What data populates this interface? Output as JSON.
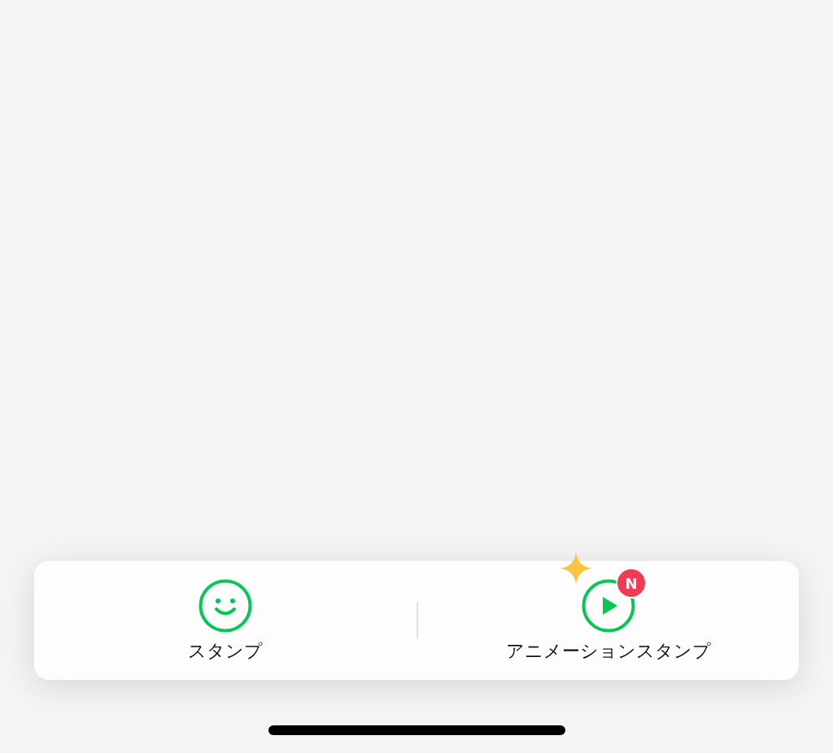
{
  "options": [
    {
      "kind": "smile",
      "label": "スタンプ",
      "sparkle": false
    },
    {
      "kind": "play",
      "label": "アニメーションスタンプ",
      "sparkle": true,
      "badge": "N"
    }
  ]
}
